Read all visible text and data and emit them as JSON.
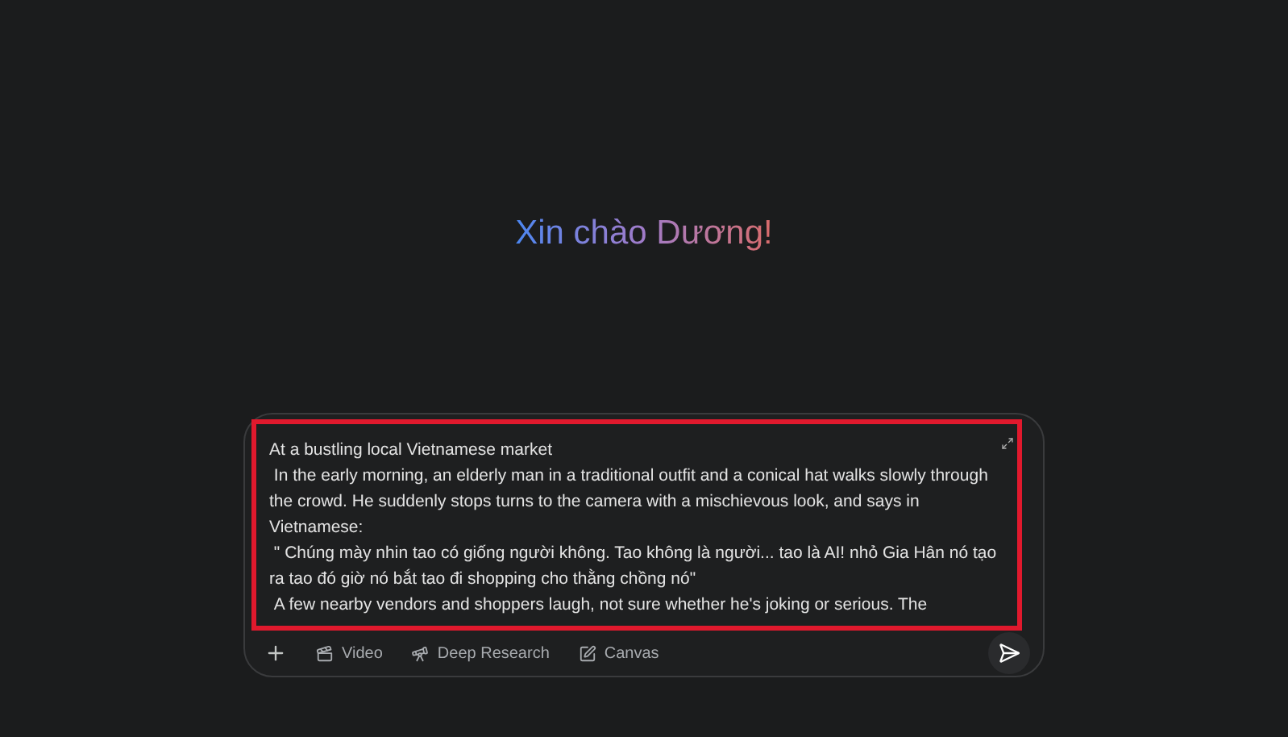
{
  "greeting": "Xin chào Dương!",
  "prompt": {
    "highlighted": true,
    "paragraphs": [
      "At a bustling local Vietnamese market",
      " In the early morning, an elderly man in a traditional outfit and a conical hat walks slowly through the crowd. He suddenly stops turns to the camera with a mischievous look, and says in Vietnamese:",
      " \" Chúng mày nhin tao có giống người không. Tao không là người... tao là AI! nhỏ Gia Hân nó tạo ra tao đó giờ nó bắt tao đi shopping cho thằng chồng nó\"",
      " A few nearby vendors and shoppers laugh, not sure whether he's joking or serious. The"
    ]
  },
  "tools": [
    {
      "kind": "video",
      "label": "Video"
    },
    {
      "kind": "research",
      "label": "Deep Research"
    },
    {
      "kind": "canvas",
      "label": "Canvas"
    }
  ]
}
